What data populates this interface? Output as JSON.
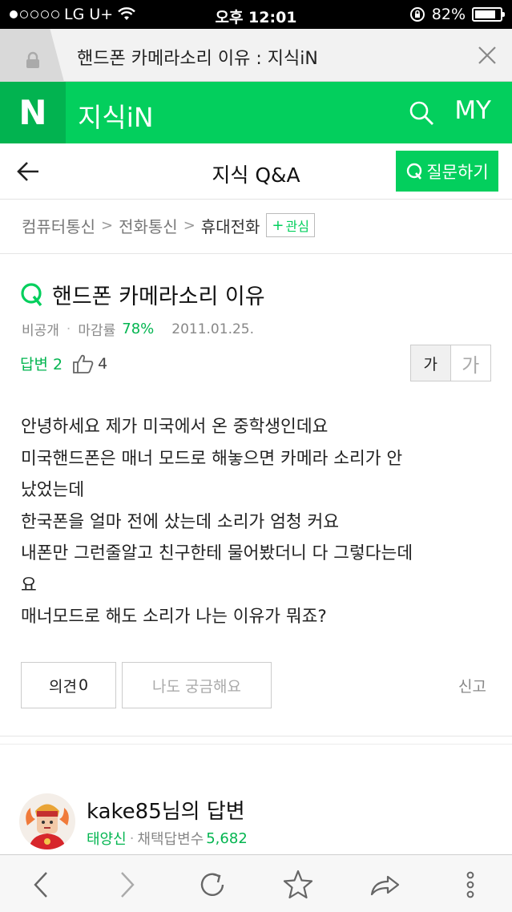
{
  "status_bar": {
    "carrier": "LG U+",
    "time": "오후 12:01",
    "battery": "82%",
    "battery_level": 0.82
  },
  "browser_tab": {
    "title": "핸드폰 카메라소리 이유 : 지식iN",
    "icons": {
      "lock": "lock-icon",
      "close": "close-icon"
    }
  },
  "header": {
    "logo": "N",
    "service": "지식iN",
    "my": "MY",
    "brand_color": "#03cf5d"
  },
  "subheader": {
    "title": "지식 Q&A",
    "ask_button": "질문하기"
  },
  "breadcrumb": {
    "items": [
      "컴퓨터통신",
      "전화통신",
      "휴대전화"
    ],
    "follow": "관심"
  },
  "question": {
    "title": "핸드폰 카메라소리 이유",
    "author": "비공개",
    "close_rate_label": "마감률",
    "close_rate": "78%",
    "date": "2011.01.25.",
    "answers_label": "답변 2",
    "likes": "4",
    "font_small": "가",
    "font_large": "가",
    "body_lines": [
      "안녕하세요 제가 미국에서 온 중학생인데요",
      "미국핸드폰은 매너 모드로 해놓으면 카메라 소리가 안",
      "났었는데",
      "한국폰을 얼마 전에 샀는데 소리가 엄청 커요",
      "내폰만 그런줄알고 친구한테 물어봤더니 다 그렇다는데",
      "요",
      "매너모드로 해도 소리가 나는 이유가 뭐죠?"
    ],
    "opinion_label": "의견",
    "opinion_count": "0",
    "curious_button": "나도 궁금해요",
    "report_button": "신고"
  },
  "answer": {
    "name": "kake85님의 답변",
    "rank": "태양신",
    "adopt_label": "채택답변수",
    "adopt_count": "5,682"
  },
  "toolbar": {
    "icons": [
      "back-icon",
      "forward-icon",
      "reload-icon",
      "bookmark-icon",
      "share-icon",
      "more-icon"
    ]
  }
}
